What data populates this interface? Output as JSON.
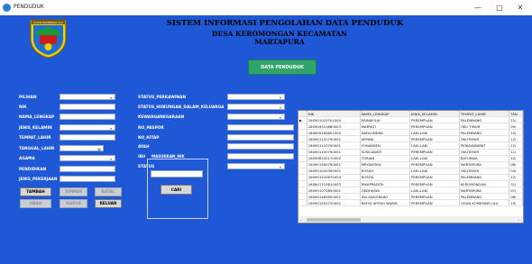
{
  "window": {
    "title": "PENDUDUK",
    "min": "—",
    "max": "□",
    "close": "✕"
  },
  "header": {
    "title": "SISTEM INFORMASI PENGOLAHAN DATA PENDUDUK",
    "subtitle": "DESA KEROMONGAN KECAMATAN MARTAPURA",
    "logo_text": "OGAN KOMERING ULU"
  },
  "data_button": "DATA PENDUDUK",
  "left_form": {
    "pilihan": "PILIHAN",
    "nik": "NIK",
    "nama": "NAMA_LENGKAP",
    "jenis_kelamin": "JENIS_KELAMIN",
    "tempat_lahir": "TEMPAT_LAHIR",
    "tanggal_lahir": "TANGGAL_LAHIR",
    "agama": "AGAMA",
    "pendidikan": "PENDIDIKAN",
    "pekerjaan": "JENIS_PEKERJAAN"
  },
  "mid_form": {
    "status_perkawinan": "STATUS_PERKAWINAN",
    "status_hubungan": "STATUS_HUBUNGAN_DALAM_KELUARGA",
    "kewarganegaraan": "KEWARGANEGARAAN",
    "no_paspor": "NO_PASPOR",
    "no_kitap": "NO_KITAP",
    "ayah": "AYAH",
    "ibu": "IBU",
    "status": "STATUS"
  },
  "buttons": {
    "tambah": "TAMBAH",
    "simpan": "SIMPAN",
    "batal": "BATAL",
    "ubah": "UBAH",
    "hapus": "HAPUS",
    "keluar": "KELUAR",
    "cari": "CARI"
  },
  "search": {
    "label": "MASUKKAN_NIK"
  },
  "grid": {
    "columns": [
      "NIK",
      "NAMA_LENGKAP",
      "JENIS_KELAMIN",
      "TEMPAT_LAHIR",
      "TAN"
    ],
    "rows": [
      [
        "160901020701000",
        "ERINAFILIA",
        "PEREMPUAN",
        "PALEMBANG",
        "12/"
      ],
      [
        "180909510680003",
        "MARYATI",
        "PEREMPUAN",
        "OKU TIMUR",
        "09/"
      ],
      [
        "160809160801000",
        "DAFALINDRA",
        "LAKI-LAKI",
        "PALEMBANG",
        "10/"
      ],
      [
        "160901120790001",
        "ARYANI",
        "PEREMPUAN",
        "OKUTIMUR",
        "12/"
      ],
      [
        "160901120790001",
        "YOHANSEN",
        "LAKI-LAKI",
        "PERJAYABARAT",
        "12/"
      ],
      [
        "160901100790001",
        "SUSILAWATI",
        "PEREMPUAN",
        "OKUTIMUR",
        "11/"
      ],
      [
        "160908100170002",
        "TORIAN",
        "LAKI-LAKI",
        "BATURAJA",
        "10/"
      ],
      [
        "160901460790001",
        "MEYANTIKA",
        "PEREMPUAN",
        "MARTAPURA",
        "06/"
      ],
      [
        "160901040390001",
        "ROSIDI",
        "LAKI-LAKI",
        "OKUTIMUR",
        "04/"
      ],
      [
        "160901520870004",
        "ROSITA",
        "PEREMPUAN",
        "PALEMBANG",
        "12/"
      ],
      [
        "160801710810003",
        "RIKAPRADITA",
        "PEREMPUAN",
        "KEROMONGAN",
        "31/"
      ],
      [
        "160901070850001",
        "OKDHIJAYA",
        "LAKI-LAKI",
        "MARTAPURA",
        "07/"
      ],
      [
        "160901460850001",
        "RIA ANGGRAINI",
        "PEREMPUAN",
        "PALEMBANG",
        "06/"
      ],
      [
        "160901550720002",
        "RAYYA AFIFAH WIJAYA",
        "PEREMPUAN",
        "OGAN KOMERING ULU",
        "15/"
      ]
    ]
  }
}
